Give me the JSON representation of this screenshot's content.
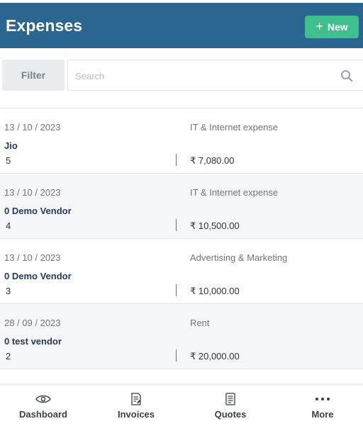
{
  "header": {
    "title": "Expenses",
    "new_label": "New",
    "background": "#2a6690",
    "new_button_color": "#3dbf8e"
  },
  "filter": {
    "label": "Filter"
  },
  "search": {
    "placeholder": "Search",
    "icon": "search-icon"
  },
  "expenses": [
    {
      "date": "13 / 10 / 2023",
      "category": "IT & Internet expense",
      "vendor": "Jio",
      "number": "5",
      "amount": "₹ 7,080.00"
    },
    {
      "date": "13 / 10 / 2023",
      "category": "IT & Internet expense",
      "vendor": "0 Demo Vendor",
      "number": "4",
      "amount": "₹ 10,500.00"
    },
    {
      "date": "13 / 10 / 2023",
      "category": "Advertising & Marketing",
      "vendor": "0 Demo Vendor",
      "number": "3",
      "amount": "₹ 10,000.00"
    },
    {
      "date": "28 / 09 / 2023",
      "category": "Rent",
      "vendor": "0 test vendor",
      "number": "2",
      "amount": "₹ 20,000.00"
    }
  ],
  "nav": [
    {
      "label": "Dashboard",
      "icon": "eye-icon"
    },
    {
      "label": "Invoices",
      "icon": "invoice-icon"
    },
    {
      "label": "Quotes",
      "icon": "document-icon"
    },
    {
      "label": "More",
      "icon": "more-dots-icon"
    }
  ]
}
